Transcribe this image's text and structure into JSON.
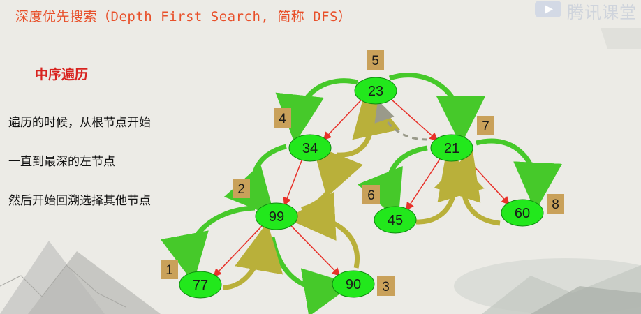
{
  "header": {
    "title": "深度优先搜索（Depth First Search, 简称 DFS）",
    "watermark": "腾讯课堂"
  },
  "content": {
    "subtitle": "中序遍历",
    "lines": [
      "遍历的时候，从根节点开始",
      "一直到最深的左节点",
      "然后开始回溯选择其他节点"
    ]
  },
  "diagram": {
    "nodes": [
      {
        "id": "n23",
        "value": "23",
        "order": "5"
      },
      {
        "id": "n34",
        "value": "34",
        "order": "4"
      },
      {
        "id": "n21",
        "value": "21",
        "order": "7"
      },
      {
        "id": "n99",
        "value": "99",
        "order": "2"
      },
      {
        "id": "n45",
        "value": "45",
        "order": "6"
      },
      {
        "id": "n60",
        "value": "60",
        "order": "8"
      },
      {
        "id": "n77",
        "value": "77",
        "order": "1"
      },
      {
        "id": "n90",
        "value": "90",
        "order": "3"
      }
    ],
    "edges": [
      [
        "n23",
        "n34"
      ],
      [
        "n23",
        "n21"
      ],
      [
        "n34",
        "n99"
      ],
      [
        "n99",
        "n77"
      ],
      [
        "n99",
        "n90"
      ],
      [
        "n21",
        "n45"
      ],
      [
        "n21",
        "n60"
      ]
    ],
    "colors": {
      "node_fill": "#22e81c",
      "node_stroke": "#0f8a10",
      "edge": "#e8312a",
      "order_badge": "#c9a15a",
      "arrow_down": "#46c92a",
      "arrow_up": "#b9b03a",
      "title": "#e8502a",
      "subtitle": "#d8231f"
    }
  }
}
